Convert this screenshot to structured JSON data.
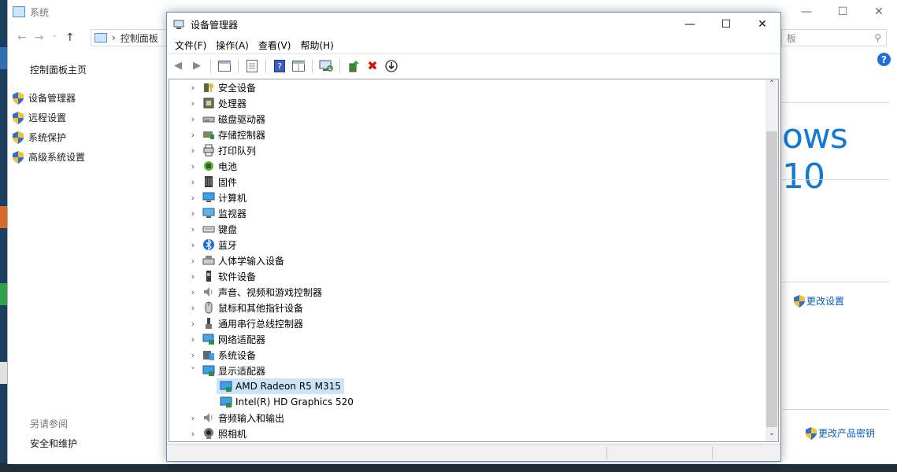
{
  "system_window": {
    "title": "系统",
    "breadcrumb": "控制面板",
    "search_text": "板",
    "home_link": "控制面板主页",
    "links": [
      "设备管理器",
      "远程设置",
      "系统保护",
      "高级系统设置"
    ],
    "see_also": "另请参阅",
    "security_link": "安全和维护",
    "brand": "ows 10",
    "change_settings": "更改设置",
    "change_key": "更改产品密钥",
    "help": "?"
  },
  "device_manager": {
    "title": "设备管理器",
    "menu": [
      "文件(F)",
      "操作(A)",
      "查看(V)",
      "帮助(H)"
    ],
    "tree": [
      {
        "label": "安全设备",
        "expanded": false,
        "icon": "security-device-icon"
      },
      {
        "label": "处理器",
        "expanded": false,
        "icon": "processor-icon"
      },
      {
        "label": "磁盘驱动器",
        "expanded": false,
        "icon": "disk-drive-icon"
      },
      {
        "label": "存储控制器",
        "expanded": false,
        "icon": "storage-controller-icon"
      },
      {
        "label": "打印队列",
        "expanded": false,
        "icon": "printer-icon"
      },
      {
        "label": "电池",
        "expanded": false,
        "icon": "battery-icon"
      },
      {
        "label": "固件",
        "expanded": false,
        "icon": "firmware-icon"
      },
      {
        "label": "计算机",
        "expanded": false,
        "icon": "computer-icon"
      },
      {
        "label": "监视器",
        "expanded": false,
        "icon": "monitor-icon"
      },
      {
        "label": "键盘",
        "expanded": false,
        "icon": "keyboard-icon"
      },
      {
        "label": "蓝牙",
        "expanded": false,
        "icon": "bluetooth-icon"
      },
      {
        "label": "人体学输入设备",
        "expanded": false,
        "icon": "hid-icon"
      },
      {
        "label": "软件设备",
        "expanded": false,
        "icon": "software-device-icon"
      },
      {
        "label": "声音、视频和游戏控制器",
        "expanded": false,
        "icon": "sound-icon"
      },
      {
        "label": "鼠标和其他指针设备",
        "expanded": false,
        "icon": "mouse-icon"
      },
      {
        "label": "通用串行总线控制器",
        "expanded": false,
        "icon": "usb-icon"
      },
      {
        "label": "网络适配器",
        "expanded": false,
        "icon": "network-adapter-icon"
      },
      {
        "label": "系统设备",
        "expanded": false,
        "icon": "system-device-icon"
      },
      {
        "label": "显示适配器",
        "expanded": true,
        "icon": "display-adapter-icon"
      },
      {
        "label": "AMD Radeon R5 M315",
        "child": true,
        "selected": true,
        "icon": "display-adapter-icon"
      },
      {
        "label": "Intel(R) HD Graphics 520",
        "child": true,
        "icon": "display-adapter-icon"
      },
      {
        "label": "音频输入和输出",
        "expanded": false,
        "icon": "audio-io-icon"
      },
      {
        "label": "照相机",
        "expanded": false,
        "icon": "camera-icon"
      }
    ]
  },
  "colors": {
    "accent": "#1479d4",
    "selection": "#cce4f7",
    "link": "#0a5bbf"
  }
}
